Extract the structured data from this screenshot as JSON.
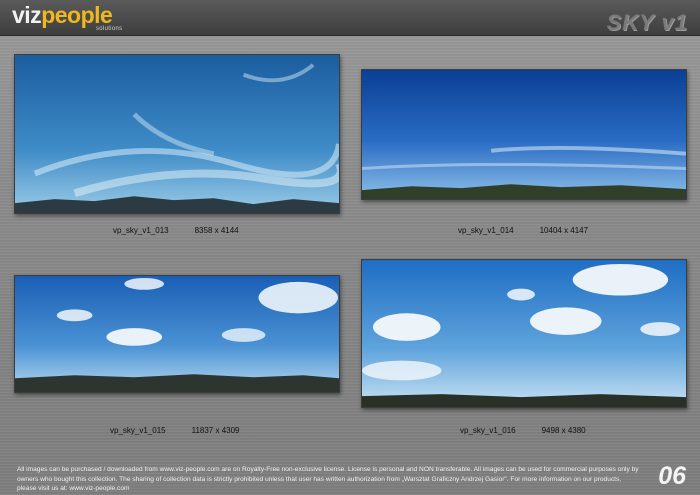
{
  "header": {
    "logo_part1": "viz",
    "logo_part2": "people",
    "logo_sub": "solutions",
    "title": "SKY v1"
  },
  "images": [
    {
      "name": "vp_sky_v1_013",
      "dims": "8358 x 4144"
    },
    {
      "name": "vp_sky_v1_014",
      "dims": "10404 x 4147"
    },
    {
      "name": "vp_sky_v1_015",
      "dims": "11837 x 4309"
    },
    {
      "name": "vp_sky_v1_016",
      "dims": "9498 x 4380"
    }
  ],
  "footer": {
    "text": "All images can be purchased / downloaded from www.viz-people.com are on Royalty-Free non-exclusive license. License is personal and NON transferable. All images can be used for commercial purposes only by owners who bought this collection. The sharing of collection data is strictly prohibited unless that user has written authorization from „Warsztat Graficzny Andrzej Gasior\". For more information on our products, please visit us at: www.viz-people.com",
    "page_number": "06"
  },
  "colors": {
    "accent": "#f1b71c",
    "header_bg": "#444444"
  }
}
